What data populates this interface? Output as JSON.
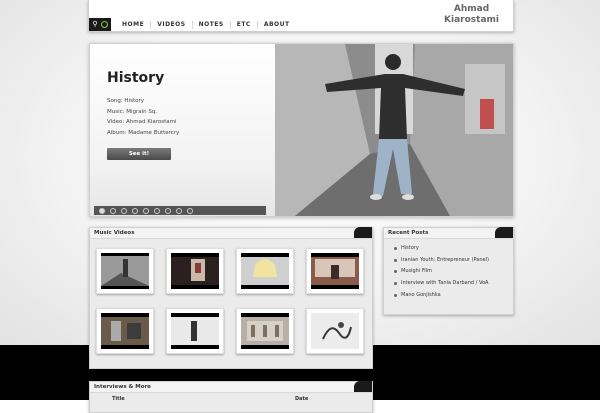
{
  "header": {
    "nav": [
      "HOME",
      "VIDEOS",
      "NOTES",
      "ETC",
      "ABOUT"
    ],
    "logo_line1": "Ahmad",
    "logo_line2": "Kiarostami"
  },
  "slider": {
    "title": "History",
    "song": "Song: History",
    "music": "Music: Migrain Sq.",
    "video": "Video: Ahmad Kiarostami",
    "album": "Album: Madame Buttercry",
    "button": "See it!",
    "slides_count": 9,
    "active_slide": 1
  },
  "music_videos": {
    "title": "Music Videos"
  },
  "recent_posts": {
    "title": "Recent Posts",
    "items": [
      "History",
      "Iranian Youth: Entrepreneur (Panel)",
      "Musighi Film",
      "Interview with Tania Darband / VoA",
      "Mano Gonjishka"
    ]
  },
  "interviews": {
    "title": "Interviews & More",
    "col_title": "Title",
    "col_date": "Date"
  },
  "colors": {
    "accent_green": "#7ecb3a",
    "dark": "#1a1a1a"
  }
}
